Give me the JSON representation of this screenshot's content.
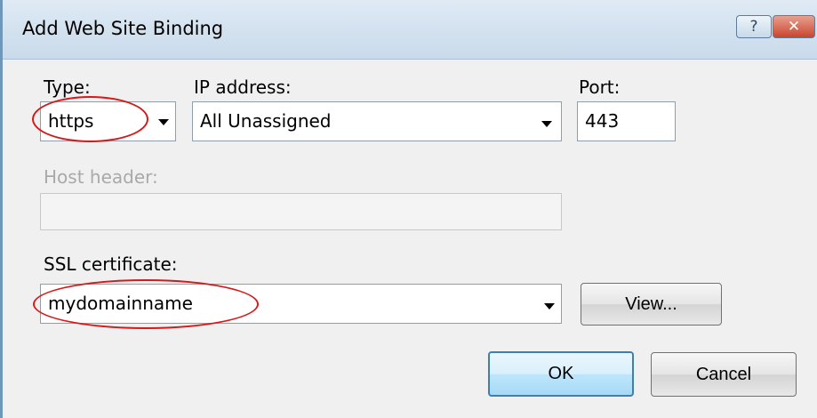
{
  "window": {
    "title": "Add Web Site Binding",
    "help_glyph": "?",
    "close_glyph": "✕"
  },
  "type": {
    "label": "Type:",
    "value": "https"
  },
  "ip": {
    "label": "IP address:",
    "value": "All Unassigned"
  },
  "port": {
    "label": "Port:",
    "value": "443"
  },
  "host": {
    "label": "Host header:",
    "value": ""
  },
  "ssl": {
    "label": "SSL certificate:",
    "value": "mydomainname"
  },
  "buttons": {
    "view": "View...",
    "ok": "OK",
    "cancel": "Cancel"
  },
  "icons": {
    "dropdown": "chevron-down-icon",
    "help": "help-icon",
    "close": "close-icon"
  },
  "annotation_color": "#d41a1a"
}
